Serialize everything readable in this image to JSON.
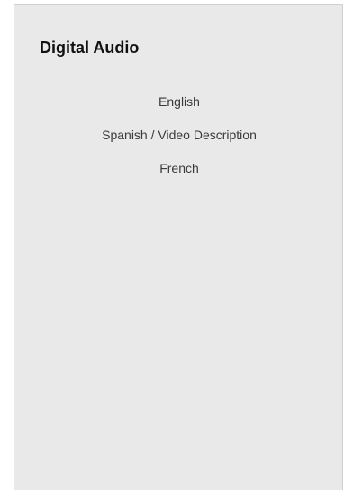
{
  "panel": {
    "title": "Digital Audio",
    "options": [
      {
        "label": "English"
      },
      {
        "label": "Spanish / Video Description"
      },
      {
        "label": "French"
      }
    ]
  }
}
